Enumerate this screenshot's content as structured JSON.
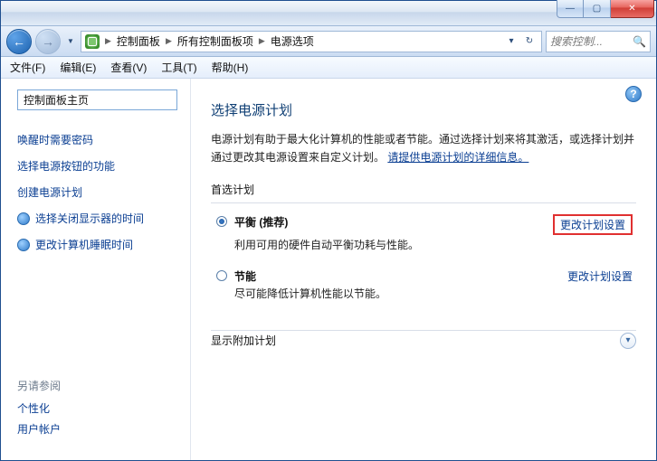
{
  "window": {
    "min_tip": "—",
    "max_tip": "▢",
    "close_tip": "✕"
  },
  "nav": {
    "back": "←",
    "forward": "→",
    "crumbs": [
      "控制面板",
      "所有控制面板项",
      "电源选项"
    ],
    "search_placeholder": "搜索控制..."
  },
  "menu": {
    "file": "文件(F)",
    "edit": "编辑(E)",
    "view": "查看(V)",
    "tools": "工具(T)",
    "help": "帮助(H)"
  },
  "sidebar": {
    "home": "控制面板主页",
    "links": [
      "唤醒时需要密码",
      "选择电源按钮的功能",
      "创建电源计划"
    ],
    "icon_links": [
      "选择关闭显示器的时间",
      "更改计算机睡眠时间"
    ],
    "see_also_hdr": "另请参阅",
    "see_also": [
      "个性化",
      "用户帐户"
    ]
  },
  "content": {
    "title": "选择电源计划",
    "desc_a": "电源计划有助于最大化计算机的性能或者节能。通过选择计划来将其激活，或选择计划并通过更改其电源设置来自定义计划。",
    "desc_link": "请提供电源计划的详细信息。",
    "pref_label": "首选计划",
    "plans": [
      {
        "name": "平衡 (推荐)",
        "sub": "利用可用的硬件自动平衡功耗与性能。",
        "link": "更改计划设置",
        "selected": true,
        "highlight": true
      },
      {
        "name": "节能",
        "sub": "尽可能降低计算机性能以节能。",
        "link": "更改计划设置",
        "selected": false,
        "highlight": false
      }
    ],
    "expand_label": "显示附加计划"
  }
}
